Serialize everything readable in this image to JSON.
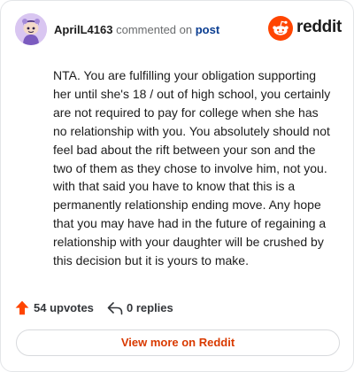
{
  "header": {
    "username": "AprilL4163",
    "commented_text": "commented on",
    "post_link": "post",
    "brand_word": "reddit",
    "avatar_icon": "snoo-avatar-icon",
    "brand_icon": "reddit-alien-icon"
  },
  "comment": {
    "text": "NTA. You are fulfilling your obligation supporting her until she's 18 / out of high school, you certainly are not required to pay for college when she has no relationship with you. You absolutely should not feel bad about the rift between your son and the two of them as they chose to involve him, not you. with that said you have to know that this is a permanently relationship ending move. Any hope that you may have had in the future of regaining a relationship with your daughter will be crushed by this decision but it is yours to make."
  },
  "stats": {
    "upvotes": "54 upvotes",
    "replies": "0 replies"
  },
  "cta": {
    "label": "View more on Reddit"
  },
  "colors": {
    "reddit_orange": "#ff4500",
    "cta_text": "#d93a00",
    "link_blue": "#0a3d91",
    "muted": "#6a6c6e"
  }
}
